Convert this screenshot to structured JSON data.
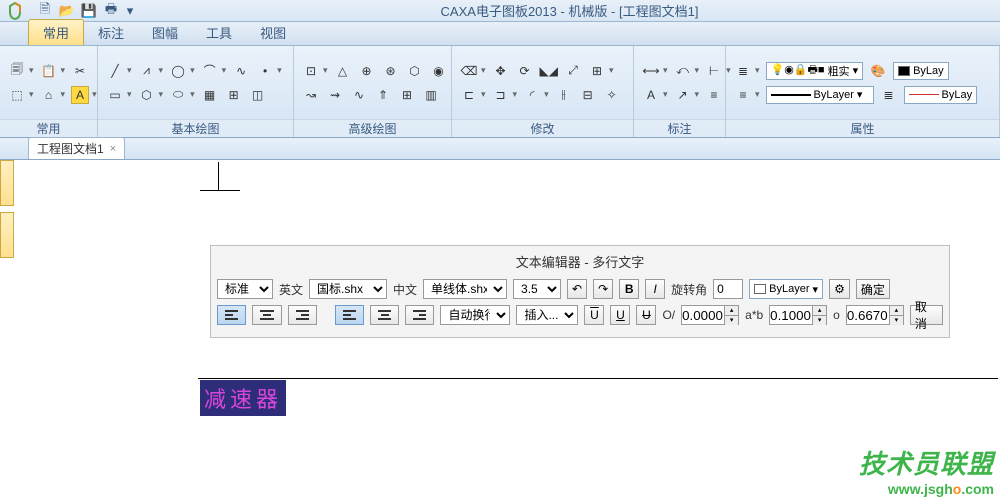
{
  "title": "CAXA电子图板2013 - 机械版 - [工程图文档1]",
  "qat": [
    "new",
    "open",
    "save",
    "print",
    "more"
  ],
  "menu": {
    "items": [
      "常用",
      "标注",
      "图幅",
      "工具",
      "视图"
    ],
    "active": 0
  },
  "ribbon": {
    "groups": [
      {
        "label": "常用"
      },
      {
        "label": "基本绘图"
      },
      {
        "label": "高级绘图"
      },
      {
        "label": "修改"
      },
      {
        "label": "标注"
      },
      {
        "label": "属性"
      }
    ],
    "props": {
      "lineweight": "粗实",
      "layer1": "ByLay",
      "layer2": "ByLayer",
      "layer3": "ByLay"
    }
  },
  "doc_tab": {
    "name": "工程图文档1"
  },
  "panel": {
    "title": "文本编辑器 - 多行文字",
    "style_label": "标准",
    "en_label": "英文",
    "en_font": "国标.shx",
    "cn_label": "中文",
    "cn_font": "单线体.shx",
    "size": "3.5",
    "bold": "B",
    "italic": "I",
    "rotate_label": "旋转角",
    "rotate_val": "0",
    "color_label": "ByLayer",
    "ok": "确定",
    "cancel": "取消",
    "wrap": "自动换行",
    "insert": "插入...",
    "u1": "U",
    "u2": "U",
    "u3": "U",
    "ol": "O/",
    "ol_val": "0.0000",
    "ab": "a*b",
    "ab_val": "0.1000",
    "o": "o",
    "o_val": "0.6670"
  },
  "seltext": "减速器",
  "watermark": {
    "l1": "技术员联盟",
    "l2a": "www.jsgh",
    "l2b": "o",
    "l2c": ".com"
  }
}
